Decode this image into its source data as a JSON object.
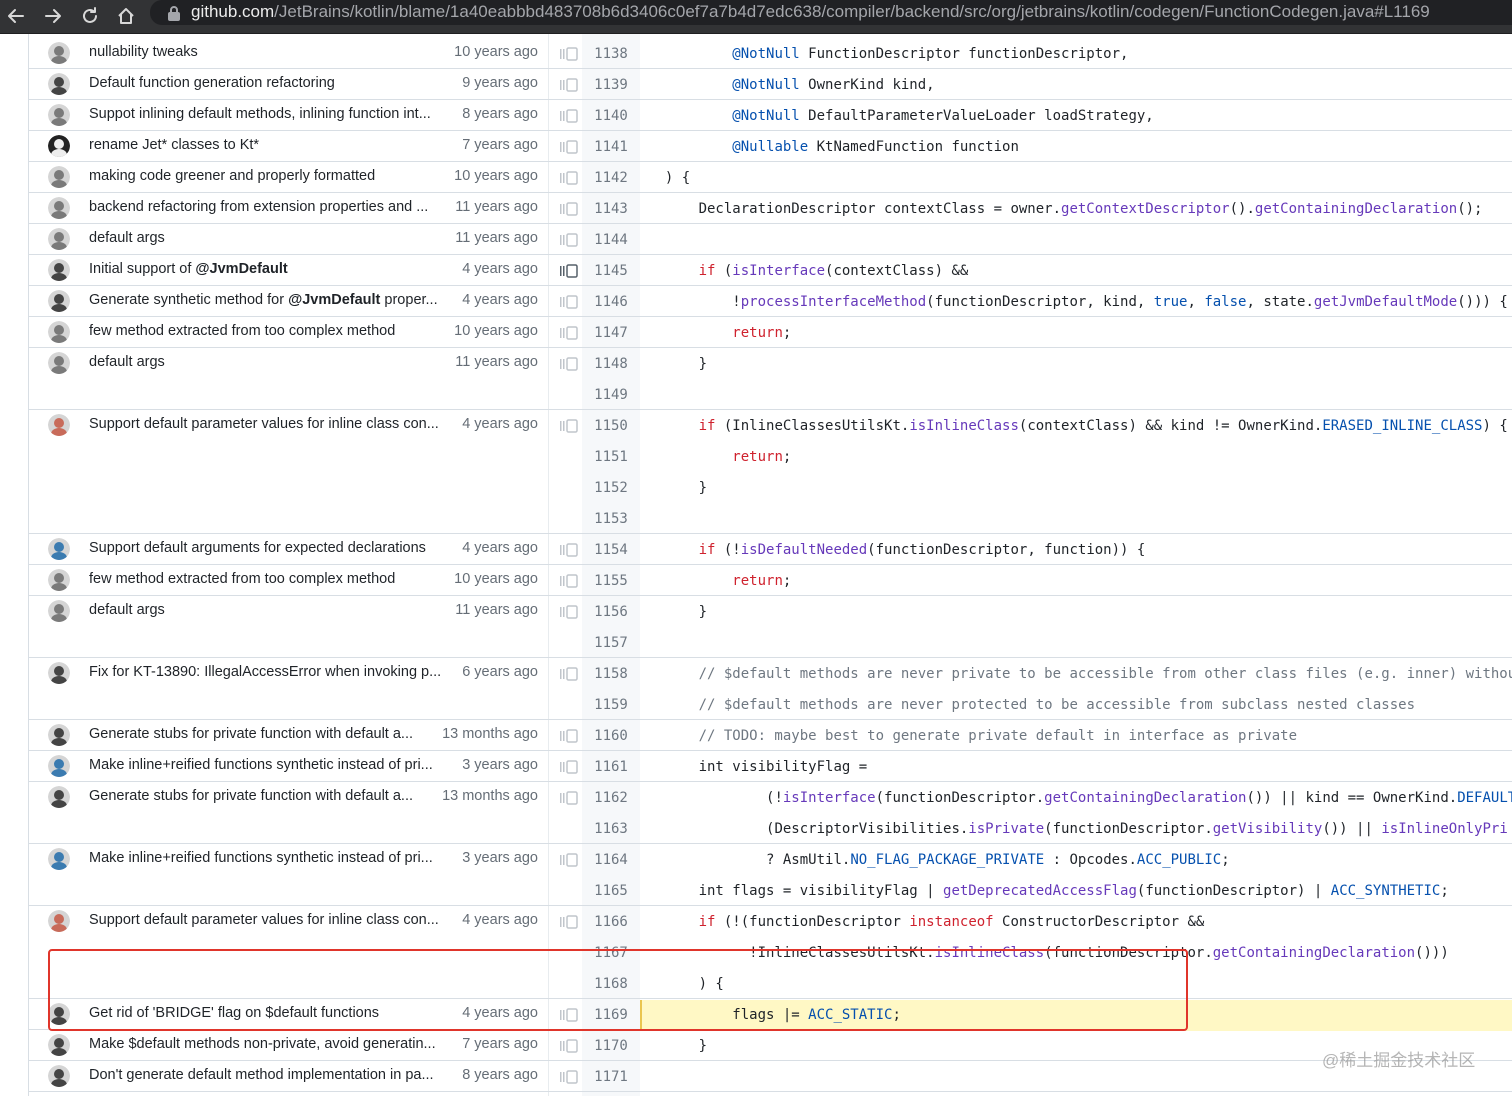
{
  "browser": {
    "url_host": "github.com",
    "url_path": "/JetBrains/kotlin/blame/1a40eabbbd483708b6d3406c0ef7a7b4d7edc638/compiler/backend/src/org/jetbrains/kotlin/codegen/FunctionCodegen.java#L1169"
  },
  "blame_hunks": [
    {
      "message": "nullability tweaks",
      "age": "10 years ago"
    },
    {
      "message": "Default function generation refactoring",
      "age": "9 years ago"
    },
    {
      "message": "Suppot inlining default methods, inlining function int...",
      "age": "8 years ago"
    },
    {
      "message": "rename Jet* classes to Kt*",
      "age": "7 years ago"
    },
    {
      "message": "making code greener and properly formatted",
      "age": "10 years ago"
    },
    {
      "message": "backend refactoring from extension properties and ...",
      "age": "11 years ago"
    },
    {
      "message": "default args",
      "age": "11 years ago"
    },
    {
      "message_prefix": "Initial support of ",
      "message_bold": "@JvmDefault",
      "message_suffix": "",
      "age": "4 years ago"
    },
    {
      "message_prefix": "Generate synthetic method for ",
      "message_bold": "@JvmDefault",
      "message_suffix": " proper...",
      "age": "4 years ago"
    },
    {
      "message": "few method extracted from too complex method",
      "age": "10 years ago"
    },
    {
      "message": "default args",
      "age": "11 years ago"
    },
    {
      "message": "Support default parameter values for inline class con...",
      "age": "4 years ago"
    },
    {
      "message": "Support default arguments for expected declarations",
      "age": "4 years ago"
    },
    {
      "message": "few method extracted from too complex method",
      "age": "10 years ago"
    },
    {
      "message": "default args",
      "age": "11 years ago"
    },
    {
      "message": "Fix for KT-13890: IllegalAccessError when invoking p...",
      "age": "6 years ago"
    },
    {
      "message": "Generate stubs for private function with default a...",
      "age": "13 months ago"
    },
    {
      "message": "Make inline+reified functions synthetic instead of pri...",
      "age": "3 years ago"
    },
    {
      "message": "Generate stubs for private function with default a...",
      "age": "13 months ago"
    },
    {
      "message": "Make inline+reified functions synthetic instead of pri...",
      "age": "3 years ago"
    },
    {
      "message": "Support default parameter values for inline class con...",
      "age": "4 years ago"
    },
    {
      "message": "Get rid of 'BRIDGE' flag on $default functions",
      "age": "4 years ago"
    },
    {
      "message": "Make $default methods non-private, avoid generatin...",
      "age": "7 years ago"
    },
    {
      "message": "Don't generate default method implementation in pa...",
      "age": "8 years ago"
    }
  ],
  "lines": [
    {
      "n": "1138"
    },
    {
      "n": "1139"
    },
    {
      "n": "1140"
    },
    {
      "n": "1141"
    },
    {
      "n": "1142"
    },
    {
      "n": "1143"
    },
    {
      "n": "1144"
    },
    {
      "n": "1145"
    },
    {
      "n": "1146"
    },
    {
      "n": "1147"
    },
    {
      "n": "1148"
    },
    {
      "n": "1149"
    },
    {
      "n": "1150"
    },
    {
      "n": "1151"
    },
    {
      "n": "1152"
    },
    {
      "n": "1153"
    },
    {
      "n": "1154"
    },
    {
      "n": "1155"
    },
    {
      "n": "1156"
    },
    {
      "n": "1157"
    },
    {
      "n": "1158"
    },
    {
      "n": "1159"
    },
    {
      "n": "1160"
    },
    {
      "n": "1161"
    },
    {
      "n": "1162"
    },
    {
      "n": "1163"
    },
    {
      "n": "1164"
    },
    {
      "n": "1165"
    },
    {
      "n": "1166"
    },
    {
      "n": "1167"
    },
    {
      "n": "1168"
    },
    {
      "n": "1169"
    },
    {
      "n": "1170"
    },
    {
      "n": "1171"
    }
  ],
  "code": {
    "l1138": [
      "@NotNull",
      " FunctionDescriptor functionDescriptor,"
    ],
    "l1139": [
      "@NotNull",
      " OwnerKind kind,"
    ],
    "l1140": [
      "@NotNull",
      " DefaultParameterValueLoader loadStrategy,"
    ],
    "l1141": [
      "@Nullable",
      " KtNamedFunction function"
    ],
    "l1142": [
      ") {"
    ],
    "l1143": [
      "DeclarationDescriptor contextClass = owner.",
      "getContextDescriptor",
      "().",
      "getContainingDeclaration",
      "();"
    ],
    "l1145": [
      "if",
      " (",
      "isInterface",
      "(contextClass) &&"
    ],
    "l1146": [
      "!",
      "processInterfaceMethod",
      "(functionDescriptor, kind, ",
      "true",
      ", ",
      "false",
      ", state.",
      "getJvmDefaultMode",
      "())) {"
    ],
    "l1147": [
      "return",
      ";"
    ],
    "l1148": [
      "}"
    ],
    "l1150": [
      "if",
      " (InlineClassesUtilsKt.",
      "isInlineClass",
      "(contextClass) && kind != OwnerKind.",
      "ERASED_INLINE_CLASS",
      ") {"
    ],
    "l1151": [
      "return",
      ";"
    ],
    "l1152": [
      "}"
    ],
    "l1154": [
      "if",
      " (!",
      "isDefaultNeeded",
      "(functionDescriptor, function)) {"
    ],
    "l1155": [
      "return",
      ";"
    ],
    "l1156": [
      "}"
    ],
    "l1158": [
      "// $default methods are never private to be accessible from other class files (e.g. inner) withou"
    ],
    "l1159": [
      "// $default methods are never protected to be accessible from subclass nested classes"
    ],
    "l1160": [
      "// TODO: maybe best to generate private default in interface as private"
    ],
    "l1161": [
      "int visibilityFlag ="
    ],
    "l1162": [
      "(!",
      "isInterface",
      "(functionDescriptor.",
      "getContainingDeclaration",
      "()) || kind == OwnerKind.",
      "DEFAULT"
    ],
    "l1163": [
      "(DescriptorVisibilities.",
      "isPrivate",
      "(functionDescriptor.",
      "getVisibility",
      "()) || ",
      "isInlineOnlyPri"
    ],
    "l1164": [
      "? AsmUtil.",
      "NO_FLAG_PACKAGE_PRIVATE",
      " : Opcodes.",
      "ACC_PUBLIC",
      ";"
    ],
    "l1165": [
      "int flags = visibilityFlag | ",
      "getDeprecatedAccessFlag",
      "(functionDescriptor) | ",
      "ACC_SYNTHETIC",
      ";"
    ],
    "l1166": [
      "if",
      " (!(functionDescriptor ",
      "instanceof",
      " ConstructorDescriptor &&"
    ],
    "l1167": [
      "!InlineClassesUtilsKt.",
      "isInlineClass",
      "(functionDescriptor.",
      "getContainingDeclaration",
      "()))"
    ],
    "l1168": [
      ") {"
    ],
    "l1169": [
      "flags |= ",
      "ACC_STATIC",
      ";"
    ],
    "l1170": [
      "}"
    ]
  },
  "colors": {
    "keyword": "#cf222e",
    "function": "#6639ba",
    "constant": "#0550ae",
    "comment": "#6e7781",
    "highlight": "#fff8c5",
    "annotation_box": "#e0352b"
  },
  "watermark": "@稀土掘金技术社区"
}
